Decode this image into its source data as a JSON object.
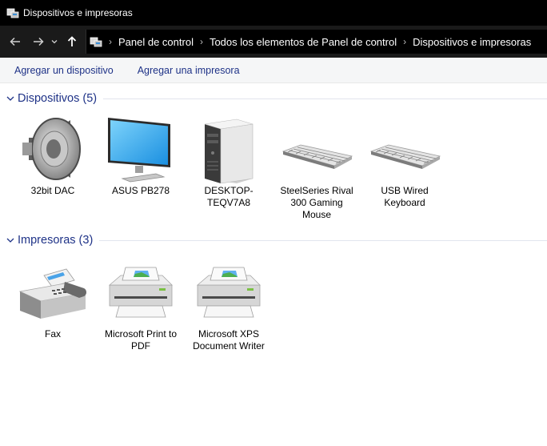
{
  "window": {
    "title": "Dispositivos e impresoras"
  },
  "breadcrumb": [
    "Panel de control",
    "Todos los elementos de Panel de control",
    "Dispositivos e impresoras"
  ],
  "commands": {
    "add_device": "Agregar un dispositivo",
    "add_printer": "Agregar una impresora"
  },
  "groups": {
    "devices": {
      "title": "Dispositivos (5)",
      "items": [
        {
          "label": "32bit DAC",
          "icon": "speaker-icon"
        },
        {
          "label": "ASUS PB278",
          "icon": "monitor-icon"
        },
        {
          "label": "DESKTOP-TEQV7A8",
          "icon": "computer-tower-icon"
        },
        {
          "label": "SteelSeries Rival 300 Gaming Mouse",
          "icon": "keyboard-icon"
        },
        {
          "label": "USB Wired Keyboard",
          "icon": "keyboard-icon"
        }
      ]
    },
    "printers": {
      "title": "Impresoras (3)",
      "items": [
        {
          "label": "Fax",
          "icon": "fax-icon"
        },
        {
          "label": "Microsoft Print to PDF",
          "icon": "printer-icon"
        },
        {
          "label": "Microsoft XPS Document Writer",
          "icon": "printer-icon"
        }
      ]
    }
  },
  "colors": {
    "titlebar": "#000000",
    "navbar": "#1a1a1a",
    "link_blue": "#1e3287",
    "group_title": "#1e3287"
  }
}
